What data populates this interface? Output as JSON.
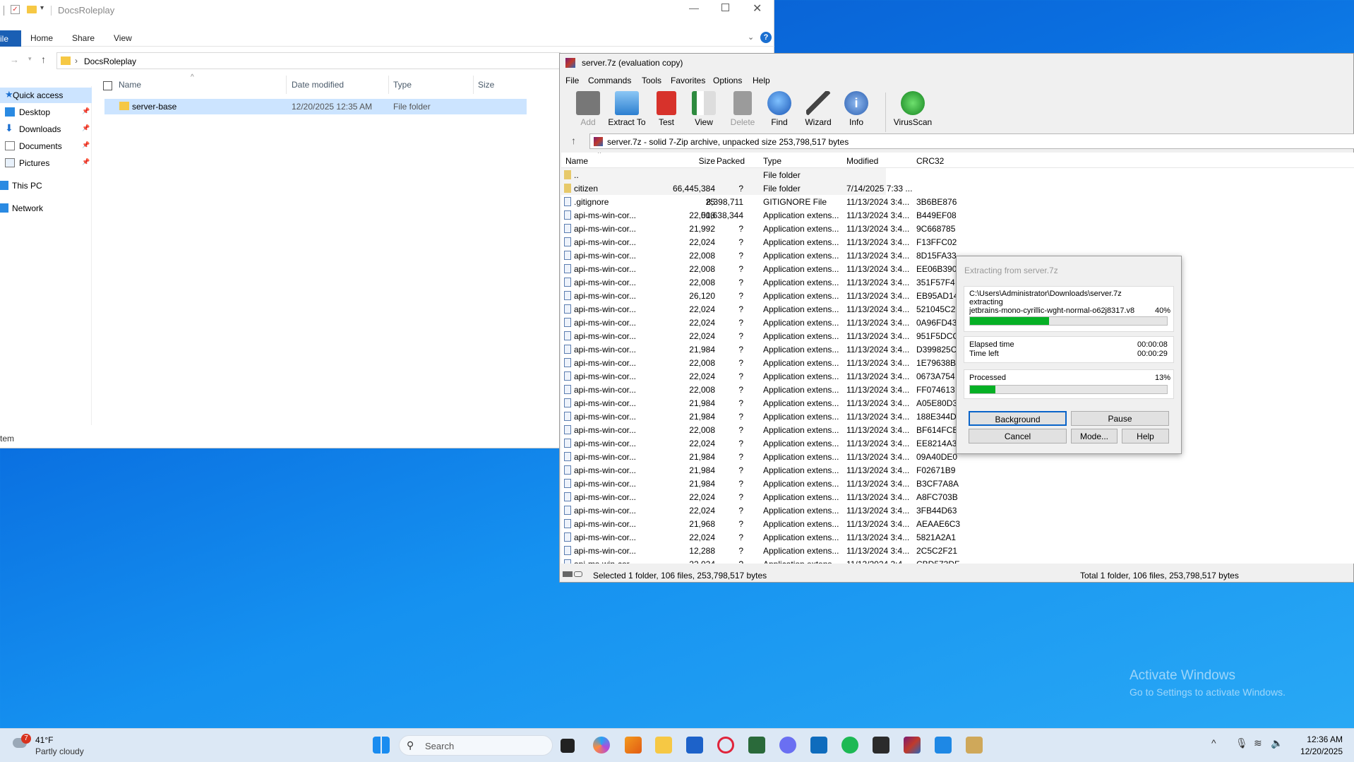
{
  "explorer": {
    "title": "DocsRoleplay",
    "tabs": [
      "ile",
      "Home",
      "Share",
      "View"
    ],
    "address": "DocsRoleplay",
    "nav": [
      {
        "label": "Quick access",
        "pinned": false
      },
      {
        "label": "Desktop",
        "pinned": true
      },
      {
        "label": "Downloads",
        "pinned": true
      },
      {
        "label": "Documents",
        "pinned": true
      },
      {
        "label": "Pictures",
        "pinned": true
      },
      {
        "label": "This PC",
        "pinned": false
      },
      {
        "label": "Network",
        "pinned": false
      }
    ],
    "columns": [
      "Name",
      "Date modified",
      "Type",
      "Size"
    ],
    "rows": [
      {
        "name": "server-base",
        "date": "12/20/2025 12:35 AM",
        "type": "File folder",
        "size": ""
      }
    ],
    "status": "tem"
  },
  "zip": {
    "title": "server.7z (evaluation copy)",
    "menu": [
      "File",
      "Commands",
      "Tools",
      "Favorites",
      "Options",
      "Help"
    ],
    "toolbar": [
      "Add",
      "Extract To",
      "Test",
      "View",
      "Delete",
      "Find",
      "Wizard",
      "Info",
      "VirusScan"
    ],
    "path": "server.7z - solid 7-Zip archive, unpacked size 253,798,517 bytes",
    "columns": [
      "Name",
      "Size",
      "Packed",
      "Type",
      "Modified",
      "CRC32"
    ],
    "rows": [
      {
        "name": "..",
        "size": "",
        "packed": "",
        "type": "File folder",
        "modified": "",
        "crc": ""
      },
      {
        "name": "citizen",
        "size": "66,445,384",
        "packed": "?",
        "type": "File folder",
        "modified": "7/14/2025 7:33 ...",
        "crc": ""
      },
      {
        "name": ".gitignore",
        "size": "25",
        "packed": "8,398,711",
        "type": "GITIGNORE File",
        "modified": "11/13/2024 3:4...",
        "crc": "3B6BE876"
      },
      {
        "name": "api-ms-win-cor...",
        "size": "22,008",
        "packed": "51,638,344",
        "type": "Application extens...",
        "modified": "11/13/2024 3:4...",
        "crc": "B449EF08"
      },
      {
        "name": "api-ms-win-cor...",
        "size": "21,992",
        "packed": "?",
        "type": "Application extens...",
        "modified": "11/13/2024 3:4...",
        "crc": "9C668785"
      },
      {
        "name": "api-ms-win-cor...",
        "size": "22,024",
        "packed": "?",
        "type": "Application extens...",
        "modified": "11/13/2024 3:4...",
        "crc": "F13FFC02"
      },
      {
        "name": "api-ms-win-cor...",
        "size": "22,008",
        "packed": "?",
        "type": "Application extens...",
        "modified": "11/13/2024 3:4...",
        "crc": "8D15FA33"
      },
      {
        "name": "api-ms-win-cor...",
        "size": "22,008",
        "packed": "?",
        "type": "Application extens...",
        "modified": "11/13/2024 3:4...",
        "crc": "EE06B390"
      },
      {
        "name": "api-ms-win-cor...",
        "size": "22,008",
        "packed": "?",
        "type": "Application extens...",
        "modified": "11/13/2024 3:4...",
        "crc": "351F57F4"
      },
      {
        "name": "api-ms-win-cor...",
        "size": "26,120",
        "packed": "?",
        "type": "Application extens...",
        "modified": "11/13/2024 3:4...",
        "crc": "EB95AD14"
      },
      {
        "name": "api-ms-win-cor...",
        "size": "22,024",
        "packed": "?",
        "type": "Application extens...",
        "modified": "11/13/2024 3:4...",
        "crc": "521045C2"
      },
      {
        "name": "api-ms-win-cor...",
        "size": "22,024",
        "packed": "?",
        "type": "Application extens...",
        "modified": "11/13/2024 3:4...",
        "crc": "0A96FD43"
      },
      {
        "name": "api-ms-win-cor...",
        "size": "22,024",
        "packed": "?",
        "type": "Application extens...",
        "modified": "11/13/2024 3:4...",
        "crc": "951F5DCC"
      },
      {
        "name": "api-ms-win-cor...",
        "size": "21,984",
        "packed": "?",
        "type": "Application extens...",
        "modified": "11/13/2024 3:4...",
        "crc": "D399825C"
      },
      {
        "name": "api-ms-win-cor...",
        "size": "22,008",
        "packed": "?",
        "type": "Application extens...",
        "modified": "11/13/2024 3:4...",
        "crc": "1E79638B"
      },
      {
        "name": "api-ms-win-cor...",
        "size": "22,024",
        "packed": "?",
        "type": "Application extens...",
        "modified": "11/13/2024 3:4...",
        "crc": "0673A754"
      },
      {
        "name": "api-ms-win-cor...",
        "size": "22,008",
        "packed": "?",
        "type": "Application extens...",
        "modified": "11/13/2024 3:4...",
        "crc": "FF074613"
      },
      {
        "name": "api-ms-win-cor...",
        "size": "21,984",
        "packed": "?",
        "type": "Application extens...",
        "modified": "11/13/2024 3:4...",
        "crc": "A05E80D3"
      },
      {
        "name": "api-ms-win-cor...",
        "size": "21,984",
        "packed": "?",
        "type": "Application extens...",
        "modified": "11/13/2024 3:4...",
        "crc": "188E344D"
      },
      {
        "name": "api-ms-win-cor...",
        "size": "22,008",
        "packed": "?",
        "type": "Application extens...",
        "modified": "11/13/2024 3:4...",
        "crc": "BF614FCB"
      },
      {
        "name": "api-ms-win-cor...",
        "size": "22,024",
        "packed": "?",
        "type": "Application extens...",
        "modified": "11/13/2024 3:4...",
        "crc": "EE8214A3"
      },
      {
        "name": "api-ms-win-cor...",
        "size": "21,984",
        "packed": "?",
        "type": "Application extens...",
        "modified": "11/13/2024 3:4...",
        "crc": "09A40DE0"
      },
      {
        "name": "api-ms-win-cor...",
        "size": "21,984",
        "packed": "?",
        "type": "Application extens...",
        "modified": "11/13/2024 3:4...",
        "crc": "F02671B9"
      },
      {
        "name": "api-ms-win-cor...",
        "size": "21,984",
        "packed": "?",
        "type": "Application extens...",
        "modified": "11/13/2024 3:4...",
        "crc": "B3CF7A8A"
      },
      {
        "name": "api-ms-win-cor...",
        "size": "22,024",
        "packed": "?",
        "type": "Application extens...",
        "modified": "11/13/2024 3:4...",
        "crc": "A8FC703B"
      },
      {
        "name": "api-ms-win-cor...",
        "size": "22,024",
        "packed": "?",
        "type": "Application extens...",
        "modified": "11/13/2024 3:4...",
        "crc": "3FB44D63"
      },
      {
        "name": "api-ms-win-cor...",
        "size": "21,968",
        "packed": "?",
        "type": "Application extens...",
        "modified": "11/13/2024 3:4...",
        "crc": "AEAAE6C3"
      },
      {
        "name": "api-ms-win-cor...",
        "size": "22,024",
        "packed": "?",
        "type": "Application extens...",
        "modified": "11/13/2024 3:4...",
        "crc": "5821A2A1"
      },
      {
        "name": "api-ms-win-cor...",
        "size": "12,288",
        "packed": "?",
        "type": "Application extens...",
        "modified": "11/13/2024 3:4...",
        "crc": "2C5C2F21"
      },
      {
        "name": "api-ms-win-cor...",
        "size": "22,024",
        "packed": "?",
        "type": "Application extens...",
        "modified": "11/13/2024 3:4...",
        "crc": "CBD573DF"
      }
    ],
    "status_left": "Selected 1 folder, 106 files, 253,798,517 bytes",
    "status_right": "Total 1 folder, 106 files, 253,798,517 bytes"
  },
  "dialog": {
    "title": "Extracting from server.7z",
    "path": "C:\\Users\\Administrator\\Downloads\\server.7z",
    "action": "extracting",
    "file": "jetbrains-mono-cyrillic-wght-normal-o62j8317.v8",
    "file_percent_label": "40%",
    "file_progress": 0.4,
    "elapsed_label": "Elapsed time",
    "elapsed": "00:00:08",
    "left_label": "Time left",
    "left": "00:00:29",
    "processed_label": "Processed",
    "processed_percent_label": "13%",
    "processed_progress": 0.13,
    "buttons": {
      "background": "Background",
      "pause": "Pause",
      "cancel": "Cancel",
      "mode": "Mode...",
      "help": "Help"
    }
  },
  "watermark": {
    "line1": "Activate Windows",
    "line2": "Go to Settings to activate Windows."
  },
  "taskbar": {
    "temperature": "41°F",
    "weather": "Partly cloudy",
    "weather_badge": "7",
    "search_placeholder": "Search",
    "time": "12:36 AM",
    "date": "12/20/2025"
  }
}
